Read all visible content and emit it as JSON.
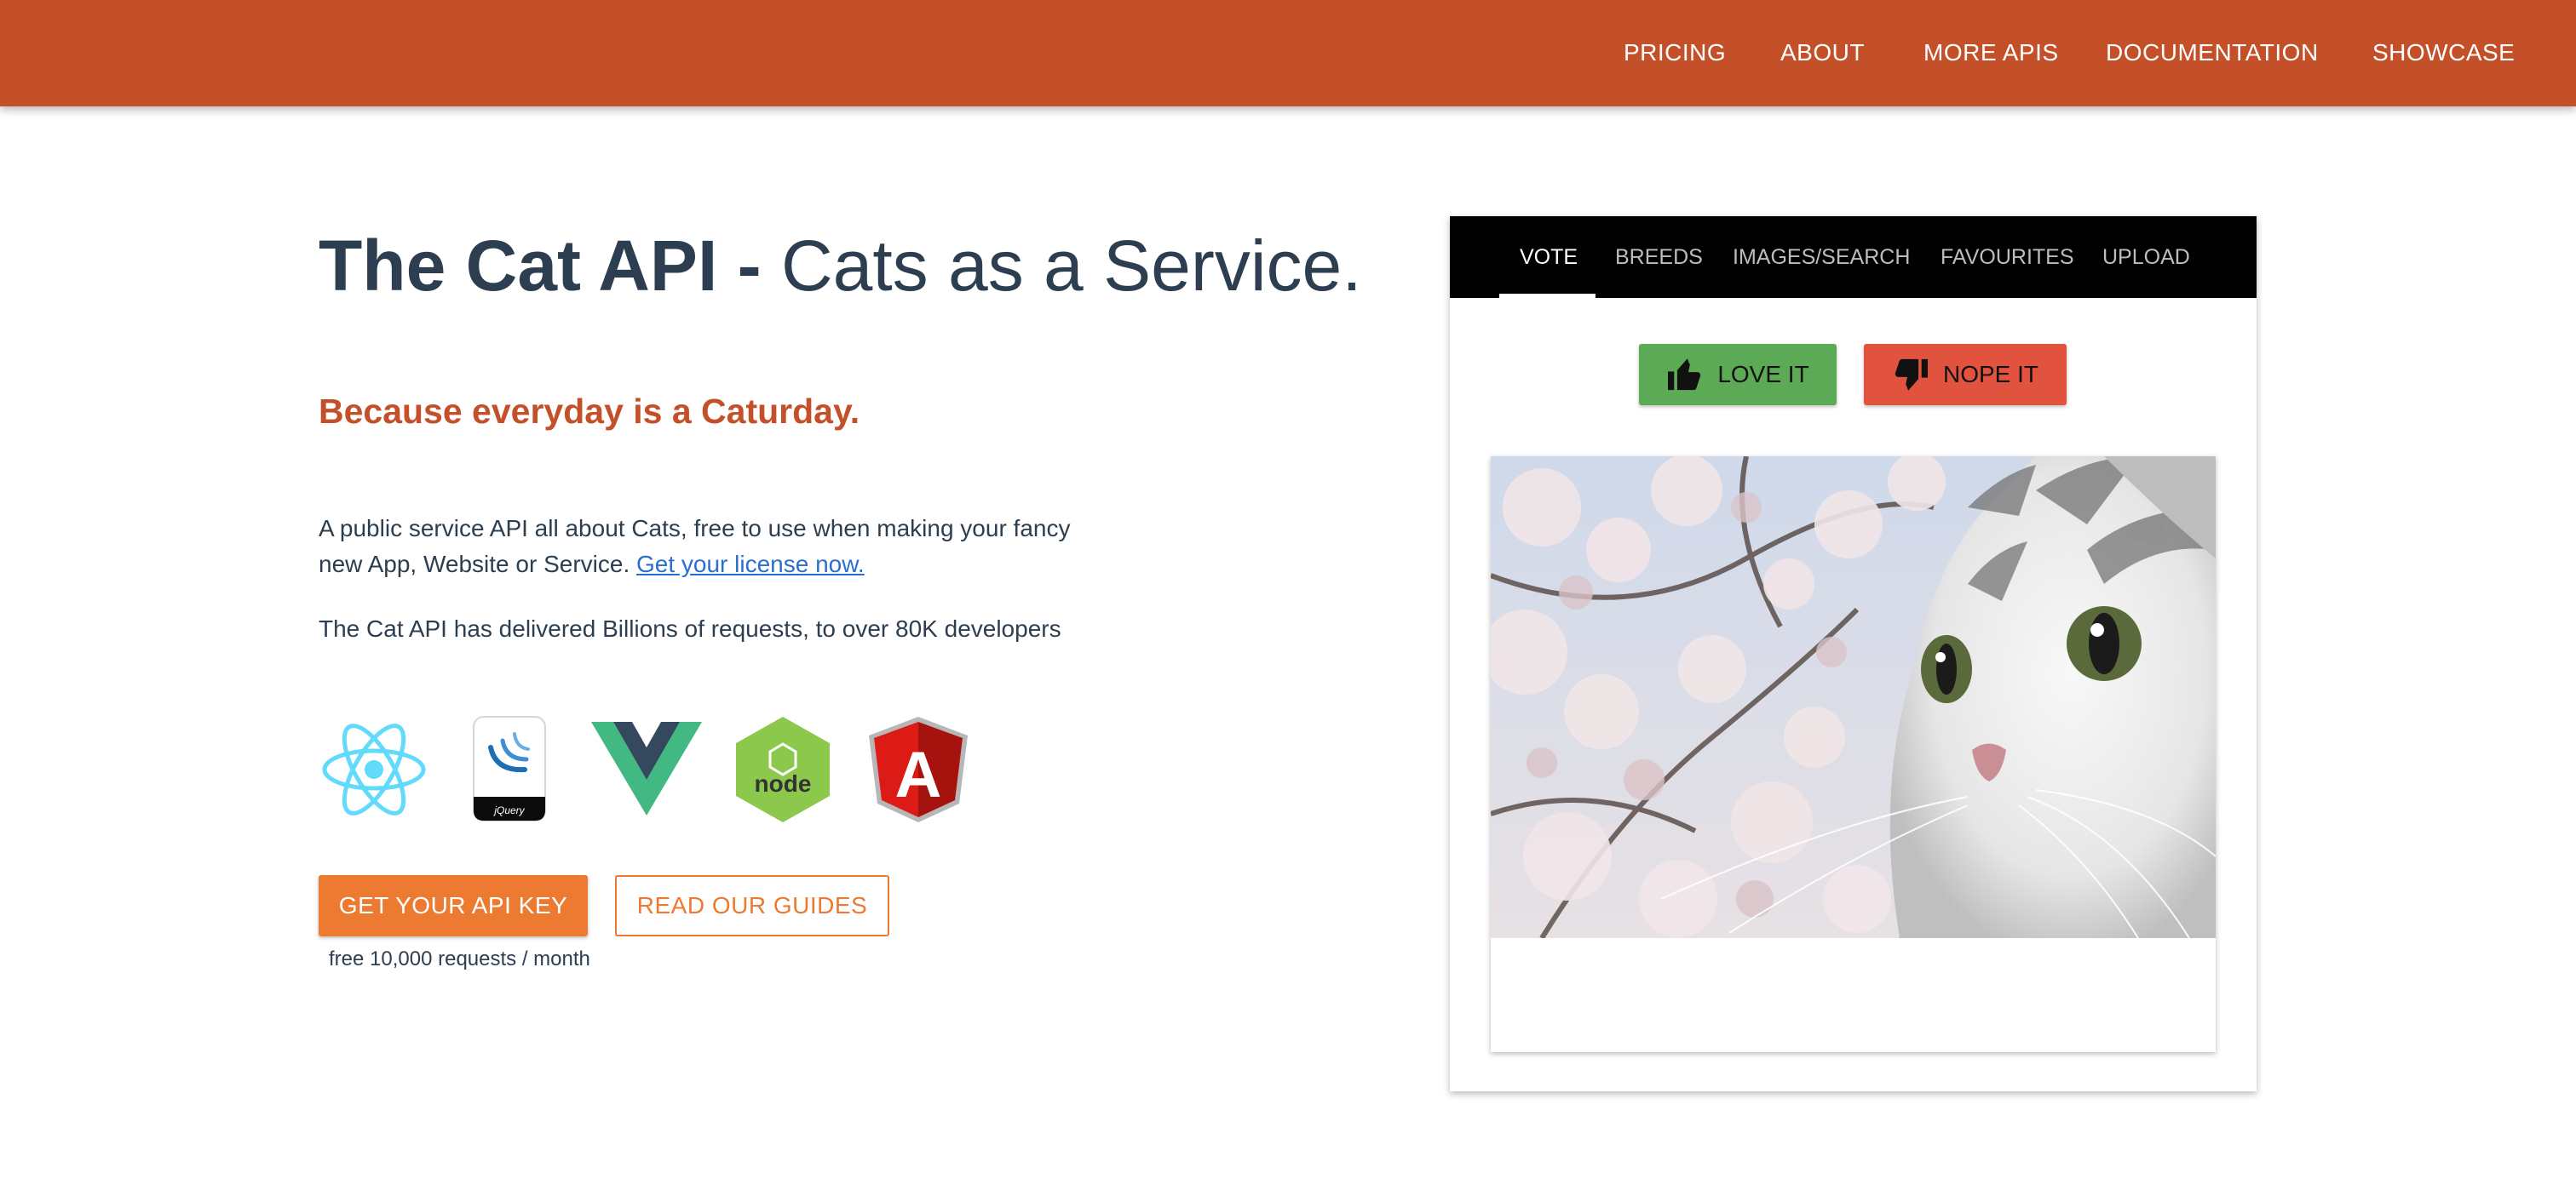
{
  "nav": {
    "links": [
      "PRICING",
      "ABOUT",
      "MORE APIS",
      "DOCUMENTATION",
      "SHOWCASE"
    ]
  },
  "hero": {
    "title_bold": "The Cat API",
    "title_sep": " - ",
    "title_rest": "Cats as a Service.",
    "tagline": "Because everyday is a Caturday.",
    "description": "A public service API all about Cats, free to use when making your fancy new App, Website or Service.",
    "license_link": "Get your license now.",
    "stats": "The Cat API has delivered Billions of requests, to over 80K developers",
    "frameworks": [
      "react-logo",
      "jquery-logo",
      "vue-logo",
      "node-logo",
      "angular-logo"
    ],
    "jquery_logo_text": "jQuery",
    "node_logo_text": "node",
    "angular_logo_text": "A"
  },
  "cta": {
    "primary": "GET YOUR API KEY",
    "secondary": "READ OUR GUIDES",
    "note": "free 10,000 requests / month"
  },
  "demo": {
    "tabs": [
      "VOTE",
      "BREEDS",
      "IMAGES/SEARCH",
      "FAVOURITES",
      "UPLOAD"
    ],
    "active_tab": "VOTE",
    "love_label": "LOVE IT",
    "nope_label": "NOPE IT",
    "love_icon": "thumbs-up-icon",
    "nope_icon": "thumbs-down-icon"
  },
  "colors": {
    "brand": "#c4502a",
    "accent": "#ec7a30",
    "love": "#5caa55",
    "nope": "#e2533f",
    "text": "#2c3e50"
  }
}
